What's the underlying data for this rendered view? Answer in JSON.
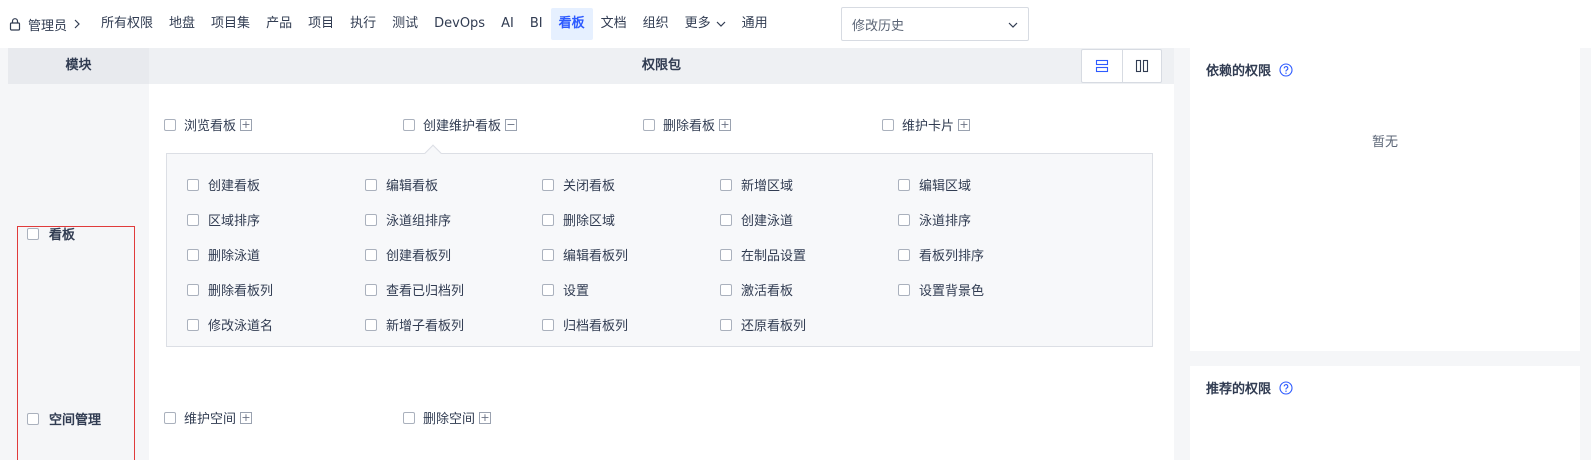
{
  "nav": {
    "breadcrumb": "管理员",
    "items": [
      "所有权限",
      "地盘",
      "项目集",
      "产品",
      "项目",
      "执行",
      "测试",
      "DevOps",
      "AI",
      "BI",
      "看板",
      "文档",
      "组织"
    ],
    "more": "更多",
    "general": "通用",
    "active": "看板",
    "history_select": "修改历史"
  },
  "table": {
    "col_module": "模块",
    "col_perm": "权限包",
    "modules": [
      "看板",
      "空间管理"
    ],
    "kanban_packages": [
      {
        "label": "浏览看板",
        "toggle": "+"
      },
      {
        "label": "创建维护看板",
        "toggle": "−"
      },
      {
        "label": "删除看板",
        "toggle": "+"
      },
      {
        "label": "维护卡片",
        "toggle": "+"
      }
    ],
    "kanban_expanded": [
      [
        "创建看板",
        "编辑看板",
        "关闭看板",
        "新增区域",
        "编辑区域"
      ],
      [
        "区域排序",
        "泳道组排序",
        "删除区域",
        "创建泳道",
        "泳道排序"
      ],
      [
        "删除泳道",
        "创建看板列",
        "编辑看板列",
        "在制品设置",
        "看板列排序"
      ],
      [
        "删除看板列",
        "查看已归档列",
        "设置",
        "激活看板",
        "设置背景色"
      ],
      [
        "修改泳道名",
        "新增子看板列",
        "归档看板列",
        "还原看板列"
      ]
    ],
    "space_packages": [
      {
        "label": "维护空间",
        "toggle": "+"
      },
      {
        "label": "删除空间",
        "toggle": "+"
      }
    ]
  },
  "right": {
    "depends_title": "依赖的权限",
    "depends_empty": "暂无",
    "recommended_title": "推荐的权限"
  },
  "colors": {
    "accent": "#2e5bff",
    "highlight_border": "#e03b3b"
  }
}
